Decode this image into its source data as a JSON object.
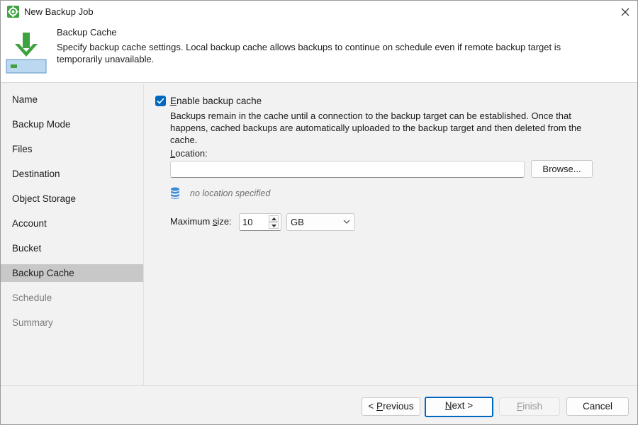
{
  "window": {
    "title": "New Backup Job"
  },
  "header": {
    "title": "Backup Cache",
    "description": "Specify backup cache settings. Local backup cache allows backups to continue on schedule even if remote backup target is temporarily unavailable."
  },
  "sidebar": {
    "items": [
      {
        "label": "Name",
        "state": "normal"
      },
      {
        "label": "Backup Mode",
        "state": "normal"
      },
      {
        "label": "Files",
        "state": "normal"
      },
      {
        "label": "Destination",
        "state": "normal"
      },
      {
        "label": "Object Storage",
        "state": "normal"
      },
      {
        "label": "Account",
        "state": "normal"
      },
      {
        "label": "Bucket",
        "state": "normal"
      },
      {
        "label": "Backup Cache",
        "state": "active"
      },
      {
        "label": "Schedule",
        "state": "disabled"
      },
      {
        "label": "Summary",
        "state": "disabled"
      }
    ]
  },
  "cache": {
    "enable_label_prefix": "E",
    "enable_label_rest": "nable backup cache",
    "enabled": true,
    "explanation": "Backups remain in the cache until a connection to the backup target can be established. Once that happens, cached backups are automatically uploaded to the backup target and then deleted from the cache.",
    "location_label_prefix": "L",
    "location_label_rest": "ocation:",
    "location_value": "",
    "browse_label": "Browse...",
    "status_text": "no location specified",
    "max_size_label_pre": "Maximum ",
    "max_size_label_underlined": "s",
    "max_size_label_post": "ize:",
    "max_size_value": "10",
    "unit": "GB"
  },
  "footer": {
    "previous_pre": "< ",
    "previous_u": "P",
    "previous_post": "revious",
    "next_u": "N",
    "next_post": "ext >",
    "finish_u": "F",
    "finish_post": "inish",
    "cancel": "Cancel"
  },
  "colors": {
    "accent": "#0067c0",
    "brand_green": "#3ea240",
    "active_nav": "#c8c8c8",
    "db_icon": "#3b8ad8"
  }
}
